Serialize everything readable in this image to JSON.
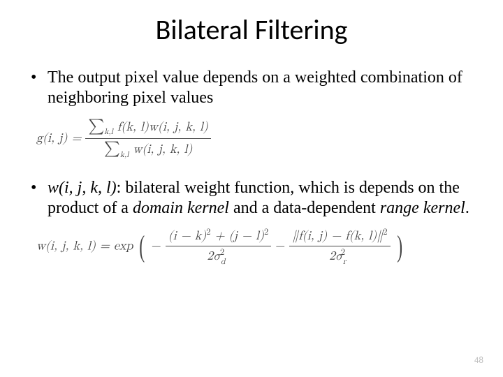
{
  "slide": {
    "title": "Bilateral Filtering",
    "bullets": [
      {
        "text": "The output pixel value depends on a weighted combination of neighboring pixel values"
      },
      {
        "prefix": "w(i, j, k, l)",
        "text": ": bilateral weight function, which is depends on the product of a ",
        "em1": "domain kernel",
        "mid": " and a data-dependent ",
        "em2": "range kernel",
        "suffix": "."
      }
    ],
    "formulas": {
      "f1_lhs": "g(i, j) = ",
      "f1_num_sum": "∑",
      "f1_num_sub": "k,l",
      "f1_num_rest": " f(k, l)w(i, j, k, l)",
      "f1_den_sum": "∑",
      "f1_den_sub": "k,l",
      "f1_den_rest": " w(i, j, k, l)",
      "f2_lhs": "w(i, j, k, l) = exp ",
      "f2_minus1": "−",
      "f2_a_num": "(i − k)",
      "f2_a_sup": "2",
      "f2_a_plus": " + (j − l)",
      "f2_a_sup2": "2",
      "f2_a_den_pre": "2σ",
      "f2_a_den_sub": "d",
      "f2_a_den_sup": "2",
      "f2_mid": " − ",
      "f2_b_num_pre": "∥f(i, j) − f(k, l)∥",
      "f2_b_num_sup": "2",
      "f2_b_den_pre": "2σ",
      "f2_b_den_sub": "r",
      "f2_b_den_sup": "2"
    },
    "page_number": "48"
  }
}
